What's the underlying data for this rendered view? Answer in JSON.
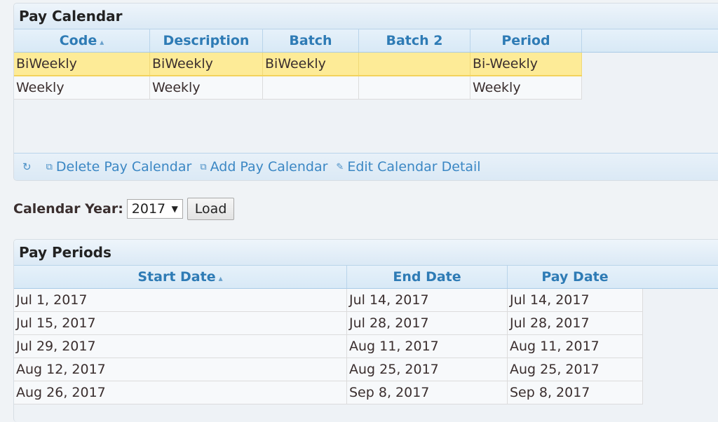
{
  "pay_calendar": {
    "title": "Pay Calendar",
    "columns": [
      "Code",
      "Description",
      "Batch",
      "Batch 2",
      "Period"
    ],
    "rows": [
      {
        "code": "BiWeekly",
        "description": "BiWeekly",
        "batch": "BiWeekly",
        "batch2": "",
        "period": "Bi-Weekly",
        "selected": true
      },
      {
        "code": "Weekly",
        "description": "Weekly",
        "batch": "",
        "batch2": "",
        "period": "Weekly",
        "selected": false
      }
    ],
    "toolbar": {
      "refresh_icon": "refresh-icon",
      "delete_label": "Delete Pay Calendar",
      "add_label": "Add Pay Calendar",
      "edit_label": "Edit Calendar Detail"
    }
  },
  "calendar_year": {
    "label": "Calendar Year:",
    "selected": "2017",
    "load_label": "Load"
  },
  "pay_periods": {
    "title": "Pay Periods",
    "columns": [
      "Start Date",
      "End Date",
      "Pay Date"
    ],
    "rows": [
      {
        "start": "Jul 1, 2017",
        "end": "Jul 14, 2017",
        "pay": "Jul 14, 2017"
      },
      {
        "start": "Jul 15, 2017",
        "end": "Jul 28, 2017",
        "pay": "Jul 28, 2017"
      },
      {
        "start": "Jul 29, 2017",
        "end": "Aug 11, 2017",
        "pay": "Aug 11, 2017"
      },
      {
        "start": "Aug 12, 2017",
        "end": "Aug 25, 2017",
        "pay": "Aug 25, 2017"
      },
      {
        "start": "Aug 26, 2017",
        "end": "Sep 8, 2017",
        "pay": "Sep 8, 2017"
      }
    ]
  }
}
